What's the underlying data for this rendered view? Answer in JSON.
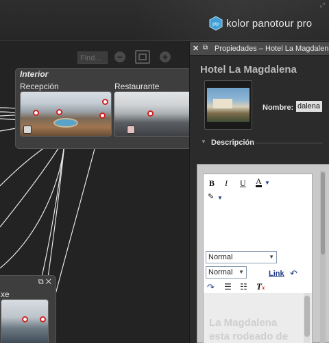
{
  "header": {
    "brand": "kolor panotour pro",
    "logo_text": "ptp"
  },
  "canvas": {
    "find_placeholder": "Find...",
    "zoom_out_icon": "minus-circle-icon",
    "zoom_fit_icon": "fit-window-icon",
    "zoom_in_icon": "plus-circle-icon",
    "groups": [
      {
        "title": "Interior",
        "nodes": [
          {
            "label": "Recepción"
          },
          {
            "label": "Restaurante"
          }
        ]
      },
      {
        "title": "",
        "nodes": [
          {
            "label": "xe"
          }
        ]
      }
    ]
  },
  "panel": {
    "title": "Propiedades – Hotel La Magdalena",
    "close_icon": "close-icon",
    "float_icon": "float-window-icon",
    "heading": "Hotel La Magdalena",
    "nombre_label": "Nombre:",
    "nombre_value": "dalena",
    "descripcion_label": "Descripción",
    "editor": {
      "bold": "B",
      "italic": "I",
      "underline": "U",
      "font_color": "A",
      "paragraph_style": "Normal",
      "font_size": "Normal",
      "link": "Link",
      "text": "La Magdalena esta rodeado de un bello entorno"
    }
  },
  "colors": {
    "background": "#232323",
    "hotspot_border": "#d02020",
    "link_blue": "#1f3a8a"
  }
}
